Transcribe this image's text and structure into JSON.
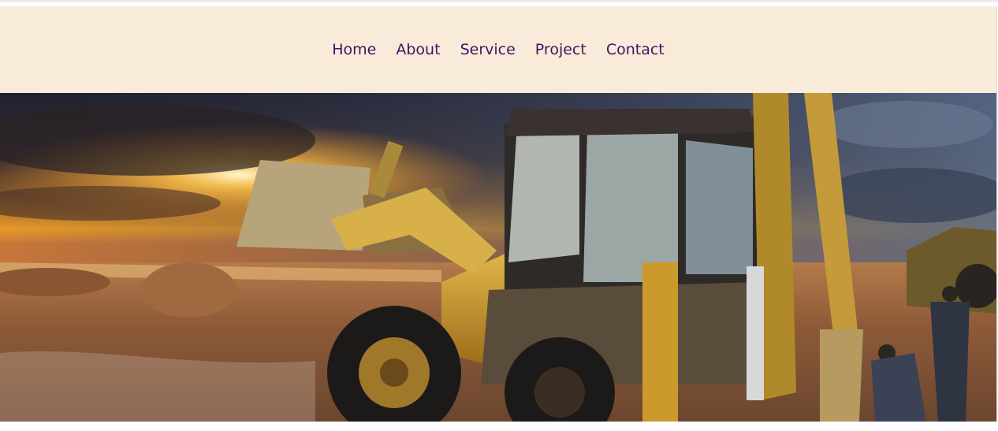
{
  "nav": {
    "items": [
      {
        "label": "Home"
      },
      {
        "label": "About"
      },
      {
        "label": "Service"
      },
      {
        "label": "Project"
      },
      {
        "label": "Contact"
      }
    ]
  },
  "colors": {
    "nav_background": "#f9ebd9",
    "nav_text": "#3f1464"
  },
  "hero": {
    "image": "construction-backhoe-loader-sunset"
  }
}
